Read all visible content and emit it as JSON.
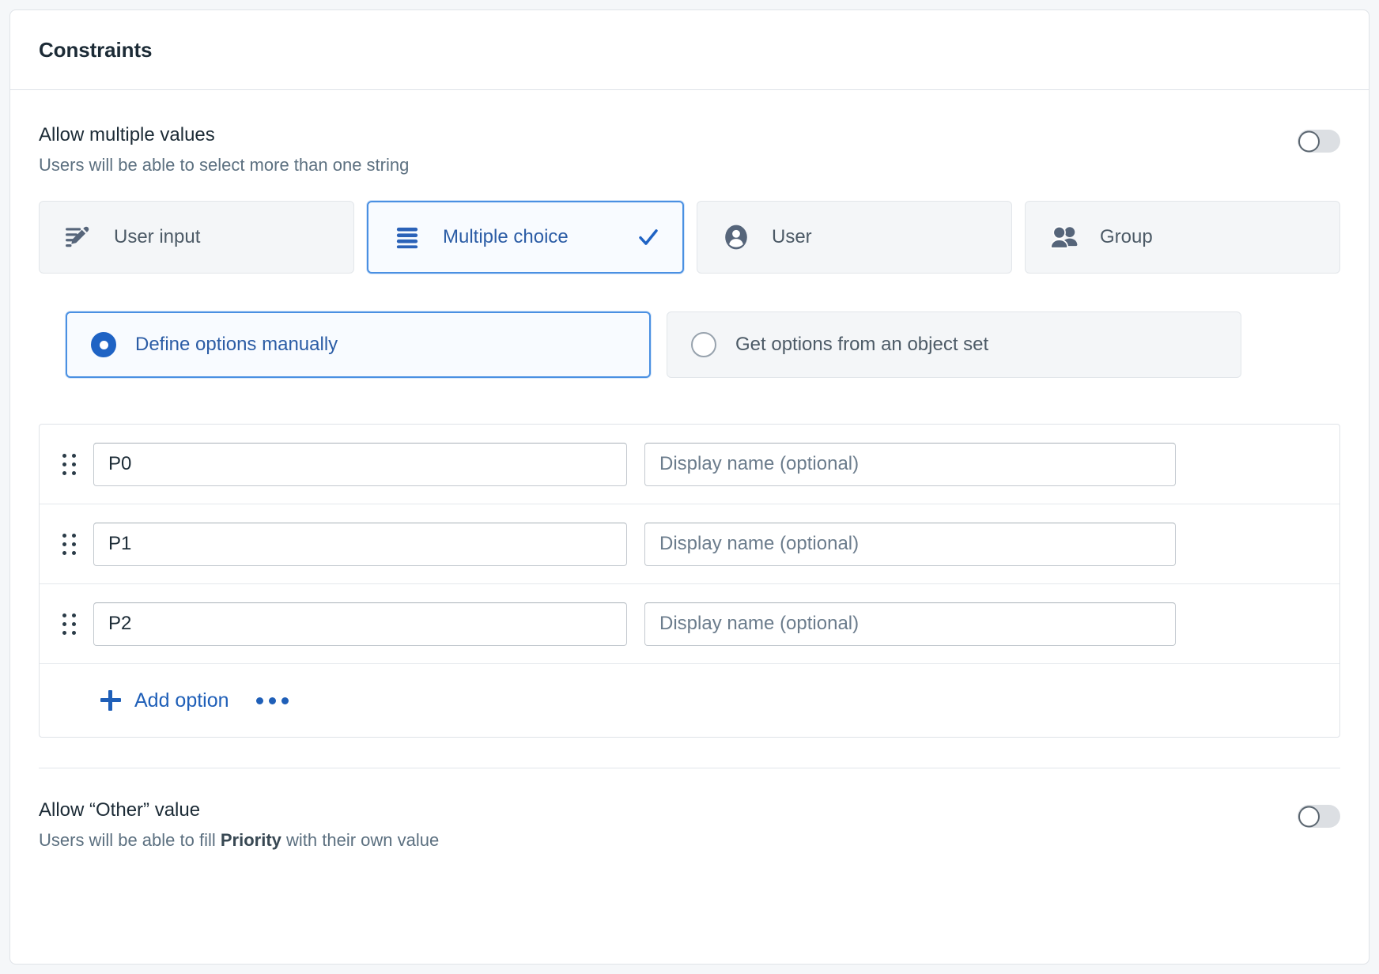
{
  "header": {
    "title": "Constraints"
  },
  "allow_multiple": {
    "label": "Allow multiple values",
    "description": "Users will be able to select more than one string",
    "toggle_state": "off"
  },
  "type_tiles": [
    {
      "label": "User input",
      "icon": "pencil-lines-icon",
      "selected": false
    },
    {
      "label": "Multiple choice",
      "icon": "list-bars-icon",
      "selected": true
    },
    {
      "label": "User",
      "icon": "user-icon",
      "selected": false
    },
    {
      "label": "Group",
      "icon": "group-icon",
      "selected": false
    }
  ],
  "source_options": [
    {
      "label": "Define options manually",
      "selected": true
    },
    {
      "label": "Get options from an object set",
      "selected": false
    }
  ],
  "options_table": {
    "rows": [
      {
        "value": "P0",
        "display_name": "",
        "display_placeholder": "Display name (optional)"
      },
      {
        "value": "P1",
        "display_name": "",
        "display_placeholder": "Display name (optional)"
      },
      {
        "value": "P2",
        "display_name": "",
        "display_placeholder": "Display name (optional)"
      }
    ],
    "add_label": "Add option",
    "more_icon": "ellipsis-icon"
  },
  "allow_other": {
    "label": "Allow “Other” value",
    "description_before": "Users will be able to fill ",
    "description_bold": "Priority",
    "description_after": " with their own value",
    "toggle_state": "off"
  },
  "colors": {
    "accent": "#1f63c4",
    "selected_border": "#4a90e2",
    "text": "#1c2b36",
    "muted": "#5c7080",
    "icon": "#56657a"
  }
}
